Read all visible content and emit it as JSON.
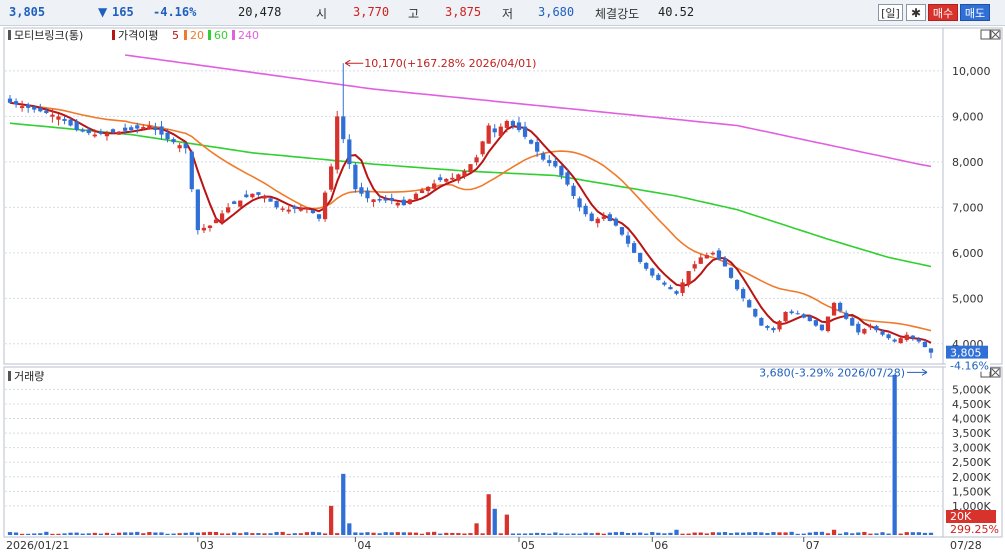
{
  "topbar": {
    "price": "3,805",
    "change_arrow": "▼",
    "change": "165",
    "change_pct": "-4.16%",
    "volume": "20,478",
    "open_label": "시",
    "open": "3,770",
    "high_label": "고",
    "high": "3,875",
    "low_label": "저",
    "low": "3,680",
    "strength_label": "체결강도",
    "strength": "40.52",
    "period_button": "[일]",
    "settings_icon": "gear-icon",
    "buy_button": "매수",
    "sell_button": "매도"
  },
  "colors": {
    "up": "#d8322c",
    "down": "#2f6fd6",
    "ma5": "#b81414",
    "ma20": "#f07a2a",
    "ma60": "#30d030",
    "ma240": "#e060e0",
    "grid": "#d8dde3",
    "volume_down": "#2f6fd6"
  },
  "chart_data": [
    {
      "type": "candlestick",
      "title": "모티브링크(통)",
      "legend": [
        {
          "name": "가격이평",
          "value": "5",
          "color": "#b81414"
        },
        {
          "name": "",
          "value": "20",
          "color": "#f07a2a"
        },
        {
          "name": "",
          "value": "60",
          "color": "#30d030"
        },
        {
          "name": "",
          "value": "240",
          "color": "#e060e0"
        }
      ],
      "ylim": [
        3600,
        10900
      ],
      "yticks": [
        "10,000",
        "9,000",
        "8,000",
        "7,000",
        "6,000",
        "5,000",
        "4,000"
      ],
      "ytick_values": [
        10000,
        9000,
        8000,
        7000,
        6000,
        5000,
        4000
      ],
      "last_price_label": "3,805",
      "last_change_label": "-4.16%",
      "last_price": 3805,
      "max_annotation": "10,170(+167.28% 2026/04/01)",
      "max_value": 10170,
      "min_annotation": "3,680(-3.29% 2026/07/28)",
      "min_value": 3680,
      "anchors_close": [
        [
          0,
          9300
        ],
        [
          4,
          9150
        ],
        [
          8,
          9000
        ],
        [
          11,
          8700
        ],
        [
          14,
          8600
        ],
        [
          17,
          8650
        ],
        [
          20,
          8700
        ],
        [
          23,
          8800
        ],
        [
          26,
          8500
        ],
        [
          29,
          8300
        ],
        [
          31,
          6500
        ],
        [
          33,
          6600
        ],
        [
          36,
          7000
        ],
        [
          38,
          7150
        ],
        [
          40,
          7300
        ],
        [
          42,
          7250
        ],
        [
          44,
          7000
        ],
        [
          46,
          6950
        ],
        [
          49,
          7000
        ],
        [
          51,
          6750
        ],
        [
          53,
          7900
        ],
        [
          54,
          9000
        ],
        [
          55,
          8500
        ],
        [
          57,
          7400
        ],
        [
          59,
          7200
        ],
        [
          61,
          7150
        ],
        [
          63,
          7150
        ],
        [
          65,
          7050
        ],
        [
          67,
          7300
        ],
        [
          69,
          7450
        ],
        [
          71,
          7600
        ],
        [
          73,
          7650
        ],
        [
          75,
          7800
        ],
        [
          77,
          8100
        ],
        [
          79,
          8800
        ],
        [
          80,
          8650
        ],
        [
          82,
          8900
        ],
        [
          84,
          8700
        ],
        [
          86,
          8400
        ],
        [
          88,
          8050
        ],
        [
          90,
          7900
        ],
        [
          92,
          7500
        ],
        [
          94,
          7000
        ],
        [
          96,
          6700
        ],
        [
          98,
          6800
        ],
        [
          100,
          6600
        ],
        [
          102,
          6200
        ],
        [
          104,
          5800
        ],
        [
          106,
          5500
        ],
        [
          108,
          5300
        ],
        [
          110,
          5100
        ],
        [
          112,
          5600
        ],
        [
          114,
          5900
        ],
        [
          116,
          6000
        ],
        [
          118,
          5700
        ],
        [
          120,
          5200
        ],
        [
          122,
          4800
        ],
        [
          124,
          4400
        ],
        [
          126,
          4300
        ],
        [
          128,
          4700
        ],
        [
          130,
          4650
        ],
        [
          132,
          4500
        ],
        [
          134,
          4300
        ],
        [
          136,
          4900
        ],
        [
          138,
          4550
        ],
        [
          140,
          4250
        ],
        [
          142,
          4400
        ],
        [
          144,
          4200
        ],
        [
          146,
          4050
        ],
        [
          148,
          4200
        ],
        [
          150,
          4050
        ],
        [
          152,
          3805
        ]
      ],
      "ma240_anchors": [
        [
          19,
          10350
        ],
        [
          30,
          10150
        ],
        [
          60,
          9600
        ],
        [
          90,
          9200
        ],
        [
          120,
          8800
        ],
        [
          150,
          7950
        ],
        [
          152,
          7900
        ]
      ],
      "ma60_anchors": [
        [
          0,
          8850
        ],
        [
          20,
          8600
        ],
        [
          40,
          8200
        ],
        [
          60,
          7950
        ],
        [
          75,
          7800
        ],
        [
          90,
          7700
        ],
        [
          110,
          7250
        ],
        [
          120,
          6950
        ],
        [
          135,
          6300
        ],
        [
          145,
          5900
        ],
        [
          152,
          5700
        ]
      ]
    },
    {
      "type": "bar",
      "title": "거래량",
      "ylim": [
        0,
        5700
      ],
      "yticks": [
        "5,000K",
        "4,500K",
        "4,000K",
        "3,500K",
        "3,000K",
        "2,500K",
        "2,000K",
        "1,500K",
        "1,000K"
      ],
      "ytick_values": [
        5000,
        4500,
        4000,
        3500,
        3000,
        2500,
        2000,
        1500,
        1000
      ],
      "last_volume_label": "20K",
      "last_volume_pct_label": "299.25%",
      "spikes": [
        {
          "index": 53,
          "value": 1000
        },
        {
          "index": 55,
          "value": 2100
        },
        {
          "index": 56,
          "value": 400
        },
        {
          "index": 77,
          "value": 400
        },
        {
          "index": 79,
          "value": 1400
        },
        {
          "index": 80,
          "value": 900
        },
        {
          "index": 82,
          "value": 700
        },
        {
          "index": 110,
          "value": 180
        },
        {
          "index": 136,
          "value": 180
        },
        {
          "index": 146,
          "value": 5500
        }
      ]
    }
  ],
  "x_axis": {
    "labels": [
      {
        "index": 0,
        "text": "2026/01/21"
      },
      {
        "index": 31,
        "text": "03"
      },
      {
        "index": 57,
        "text": "04"
      },
      {
        "index": 84,
        "text": "05"
      },
      {
        "index": 106,
        "text": "06"
      },
      {
        "index": 131,
        "text": "07"
      },
      {
        "index": 152,
        "text": "07/28"
      }
    ]
  }
}
